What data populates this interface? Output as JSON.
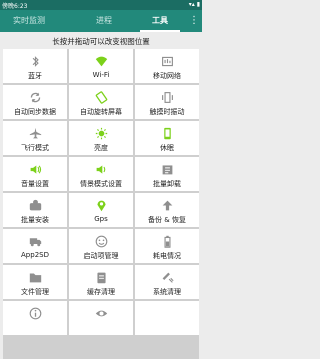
{
  "status_bar": {
    "carrier_time": "傍晚6:23",
    "right": "▾▴ ▮"
  },
  "tabs": [
    {
      "label": "实时监测",
      "active": false
    },
    {
      "label": "进程",
      "active": false
    },
    {
      "label": "工具",
      "active": true
    }
  ],
  "overflow_icon": "⋮",
  "hint": "长按并拖动可以改变视图位置",
  "colors": {
    "active_green": "#7cd11a",
    "inactive_gray": "#8f8f8f",
    "tabbar": "#22897b",
    "statusbar": "#1b6d63"
  },
  "tools": [
    {
      "label": "蓝牙",
      "icon": "bluetooth-icon",
      "active": false
    },
    {
      "label": "Wi-Fi",
      "icon": "wifi-icon",
      "active": true
    },
    {
      "label": "移动网络",
      "icon": "mobile-data-icon",
      "active": false
    },
    {
      "label": "自动同步数据",
      "icon": "sync-icon",
      "active": false
    },
    {
      "label": "自动旋转屏幕",
      "icon": "rotate-icon",
      "active": true
    },
    {
      "label": "触摸时振动",
      "icon": "vibrate-icon",
      "active": false
    },
    {
      "label": "飞行模式",
      "icon": "airplane-icon",
      "active": false
    },
    {
      "label": "亮度",
      "icon": "brightness-icon",
      "active": true
    },
    {
      "label": "休眠",
      "icon": "sleep-icon",
      "active": true
    },
    {
      "label": "音量设置",
      "icon": "volume-icon",
      "active": true
    },
    {
      "label": "情景模式设置",
      "icon": "scene-mode-icon",
      "active": true
    },
    {
      "label": "批量卸载",
      "icon": "batch-uninstall-icon",
      "active": false
    },
    {
      "label": "批量安装",
      "icon": "batch-install-icon",
      "active": false
    },
    {
      "label": "Gps",
      "icon": "gps-icon",
      "active": true
    },
    {
      "label": "备份 & 恢复",
      "icon": "backup-restore-icon",
      "active": false
    },
    {
      "label": "App2SD",
      "icon": "app2sd-icon",
      "active": false
    },
    {
      "label": "启动项管理",
      "icon": "startup-icon",
      "active": false
    },
    {
      "label": "耗电情况",
      "icon": "battery-icon",
      "active": false
    },
    {
      "label": "文件管理",
      "icon": "folder-icon",
      "active": false
    },
    {
      "label": "缓存清理",
      "icon": "cache-clean-icon",
      "active": false
    },
    {
      "label": "系统清理",
      "icon": "system-clean-icon",
      "active": false
    },
    {
      "label": "",
      "icon": "info-icon",
      "active": false
    },
    {
      "label": "",
      "icon": "eye-icon",
      "active": false
    },
    {
      "label": "",
      "icon": "",
      "active": false
    }
  ]
}
